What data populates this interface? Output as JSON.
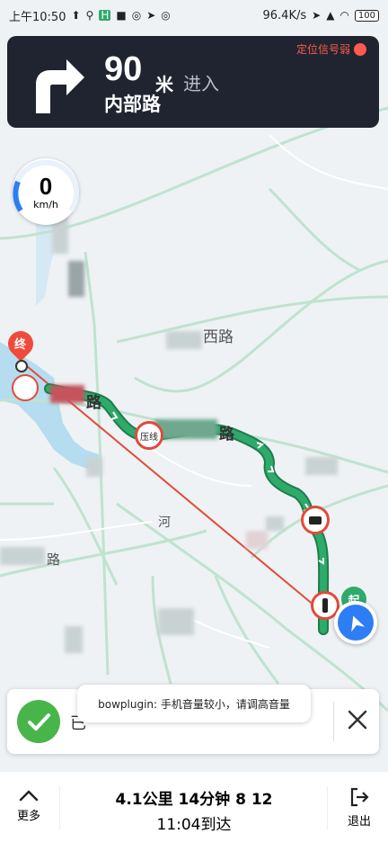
{
  "status_bar": {
    "time": "上午10:50",
    "net_speed": "96.4K/s",
    "battery": "100"
  },
  "nav": {
    "distance": "90",
    "distance_unit": "米",
    "action": "进入",
    "road": "内部路",
    "gps_warning": "定位信号弱"
  },
  "speed": {
    "value": "0",
    "unit": "km/h"
  },
  "map_labels": {
    "west_road": "西路",
    "road1": "路",
    "road2": "路",
    "river": "河",
    "road3": "路",
    "start_marker": "起",
    "end_marker": "终",
    "pressline_sign": "压线"
  },
  "toast": {
    "text": "已"
  },
  "tooltip": {
    "text": "bowplugin: 手机音量较小，请调高音量"
  },
  "bottom": {
    "more_label": "更多",
    "trip_summary": "4.1公里 14分钟 8 12",
    "eta": "11:04到达",
    "exit_label": "退出"
  },
  "colors": {
    "route_green": "#2eaa6a",
    "direct_line": "#e24a3a",
    "panel_bg": "#1f2430",
    "accent_blue": "#2d7df4"
  }
}
